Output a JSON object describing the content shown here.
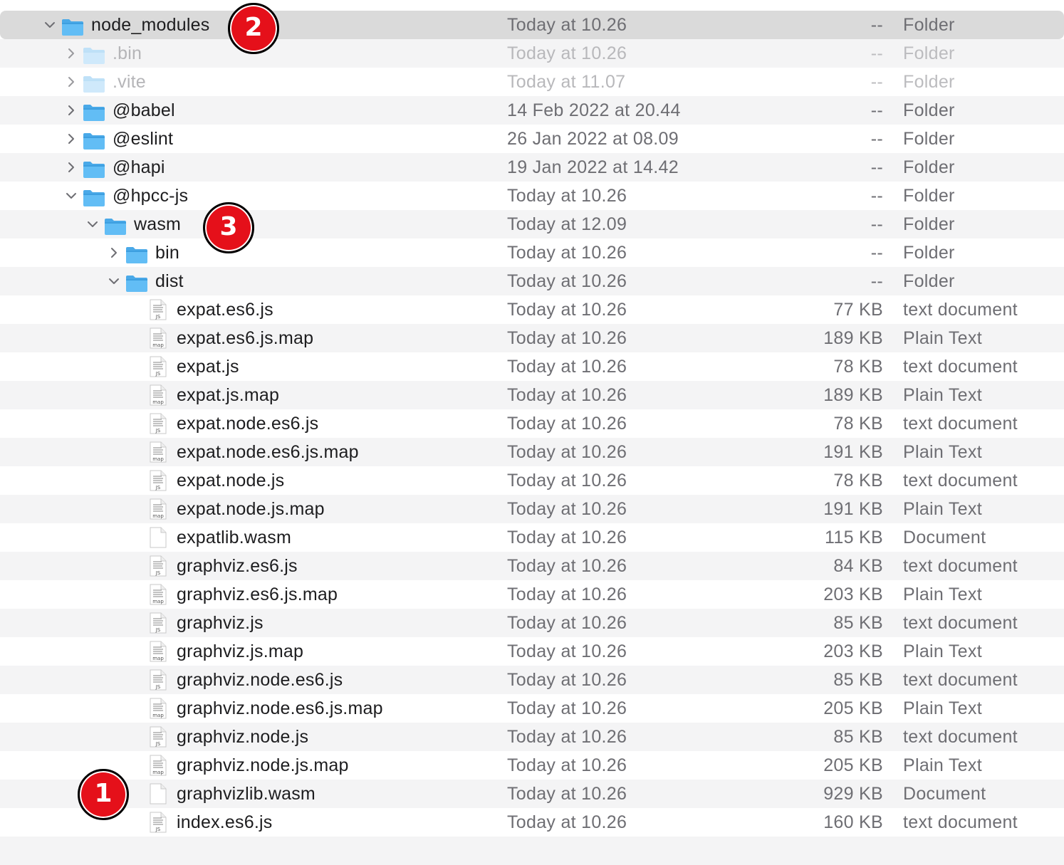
{
  "accent": "#5ab4f0",
  "badge_color": "#e5101a",
  "rows": [
    {
      "name": "node_modules",
      "date": "Today at 10.26",
      "size": "--",
      "kind": "Folder",
      "level": 0,
      "expanded": true,
      "icon": "folder-icon",
      "selected": true
    },
    {
      "name": ".bin",
      "date": "Today at 10.26",
      "size": "--",
      "kind": "Folder",
      "level": 1,
      "expanded": false,
      "icon": "folder-icon",
      "dim": true
    },
    {
      "name": ".vite",
      "date": "Today at 11.07",
      "size": "--",
      "kind": "Folder",
      "level": 1,
      "expanded": false,
      "icon": "folder-icon",
      "dim": true
    },
    {
      "name": "@babel",
      "date": "14 Feb 2022 at 20.44",
      "size": "--",
      "kind": "Folder",
      "level": 1,
      "expanded": false,
      "icon": "folder-icon"
    },
    {
      "name": "@eslint",
      "date": "26 Jan 2022 at 08.09",
      "size": "--",
      "kind": "Folder",
      "level": 1,
      "expanded": false,
      "icon": "folder-icon"
    },
    {
      "name": "@hapi",
      "date": "19 Jan 2022 at 14.42",
      "size": "--",
      "kind": "Folder",
      "level": 1,
      "expanded": false,
      "icon": "folder-icon"
    },
    {
      "name": "@hpcc-js",
      "date": "Today at 10.26",
      "size": "--",
      "kind": "Folder",
      "level": 1,
      "expanded": true,
      "icon": "folder-icon"
    },
    {
      "name": "wasm",
      "date": "Today at 12.09",
      "size": "--",
      "kind": "Folder",
      "level": 2,
      "expanded": true,
      "icon": "folder-icon"
    },
    {
      "name": "bin",
      "date": "Today at 10.26",
      "size": "--",
      "kind": "Folder",
      "level": 3,
      "expanded": false,
      "icon": "folder-icon"
    },
    {
      "name": "dist",
      "date": "Today at 10.26",
      "size": "--",
      "kind": "Folder",
      "level": 3,
      "expanded": true,
      "icon": "folder-icon"
    },
    {
      "name": "expat.es6.js",
      "date": "Today at 10.26",
      "size": "77 KB",
      "kind": "text document",
      "level": 4,
      "icon": "js-file-icon",
      "icon_tag": "JS"
    },
    {
      "name": "expat.es6.js.map",
      "date": "Today at 10.26",
      "size": "189 KB",
      "kind": "Plain Text",
      "level": 4,
      "icon": "map-file-icon",
      "icon_tag": "map"
    },
    {
      "name": "expat.js",
      "date": "Today at 10.26",
      "size": "78 KB",
      "kind": "text document",
      "level": 4,
      "icon": "js-file-icon",
      "icon_tag": "JS"
    },
    {
      "name": "expat.js.map",
      "date": "Today at 10.26",
      "size": "189 KB",
      "kind": "Plain Text",
      "level": 4,
      "icon": "map-file-icon",
      "icon_tag": "map"
    },
    {
      "name": "expat.node.es6.js",
      "date": "Today at 10.26",
      "size": "78 KB",
      "kind": "text document",
      "level": 4,
      "icon": "js-file-icon",
      "icon_tag": "JS"
    },
    {
      "name": "expat.node.es6.js.map",
      "date": "Today at 10.26",
      "size": "191 KB",
      "kind": "Plain Text",
      "level": 4,
      "icon": "map-file-icon",
      "icon_tag": "map"
    },
    {
      "name": "expat.node.js",
      "date": "Today at 10.26",
      "size": "78 KB",
      "kind": "text document",
      "level": 4,
      "icon": "js-file-icon",
      "icon_tag": "JS"
    },
    {
      "name": "expat.node.js.map",
      "date": "Today at 10.26",
      "size": "191 KB",
      "kind": "Plain Text",
      "level": 4,
      "icon": "map-file-icon",
      "icon_tag": "map"
    },
    {
      "name": "expatlib.wasm",
      "date": "Today at 10.26",
      "size": "115 KB",
      "kind": "Document",
      "level": 4,
      "icon": "blank-file-icon"
    },
    {
      "name": "graphviz.es6.js",
      "date": "Today at 10.26",
      "size": "84 KB",
      "kind": "text document",
      "level": 4,
      "icon": "js-file-icon",
      "icon_tag": "JS"
    },
    {
      "name": "graphviz.es6.js.map",
      "date": "Today at 10.26",
      "size": "203 KB",
      "kind": "Plain Text",
      "level": 4,
      "icon": "map-file-icon",
      "icon_tag": "map"
    },
    {
      "name": "graphviz.js",
      "date": "Today at 10.26",
      "size": "85 KB",
      "kind": "text document",
      "level": 4,
      "icon": "js-file-icon",
      "icon_tag": "JS"
    },
    {
      "name": "graphviz.js.map",
      "date": "Today at 10.26",
      "size": "203 KB",
      "kind": "Plain Text",
      "level": 4,
      "icon": "map-file-icon",
      "icon_tag": "map"
    },
    {
      "name": "graphviz.node.es6.js",
      "date": "Today at 10.26",
      "size": "85 KB",
      "kind": "text document",
      "level": 4,
      "icon": "js-file-icon",
      "icon_tag": "JS"
    },
    {
      "name": "graphviz.node.es6.js.map",
      "date": "Today at 10.26",
      "size": "205 KB",
      "kind": "Plain Text",
      "level": 4,
      "icon": "map-file-icon",
      "icon_tag": "map"
    },
    {
      "name": "graphviz.node.js",
      "date": "Today at 10.26",
      "size": "85 KB",
      "kind": "text document",
      "level": 4,
      "icon": "js-file-icon",
      "icon_tag": "JS"
    },
    {
      "name": "graphviz.node.js.map",
      "date": "Today at 10.26",
      "size": "205 KB",
      "kind": "Plain Text",
      "level": 4,
      "icon": "map-file-icon",
      "icon_tag": "map"
    },
    {
      "name": "graphvizlib.wasm",
      "date": "Today at 10.26",
      "size": "929 KB",
      "kind": "Document",
      "level": 4,
      "icon": "blank-file-icon"
    },
    {
      "name": "index.es6.js",
      "date": "Today at 10.26",
      "size": "160 KB",
      "kind": "text document",
      "level": 4,
      "icon": "js-file-icon",
      "icon_tag": "JS"
    }
  ],
  "annotations": [
    {
      "label": "2",
      "row": 0
    },
    {
      "label": "3",
      "row": 7
    },
    {
      "label": "1",
      "row": 27
    }
  ]
}
